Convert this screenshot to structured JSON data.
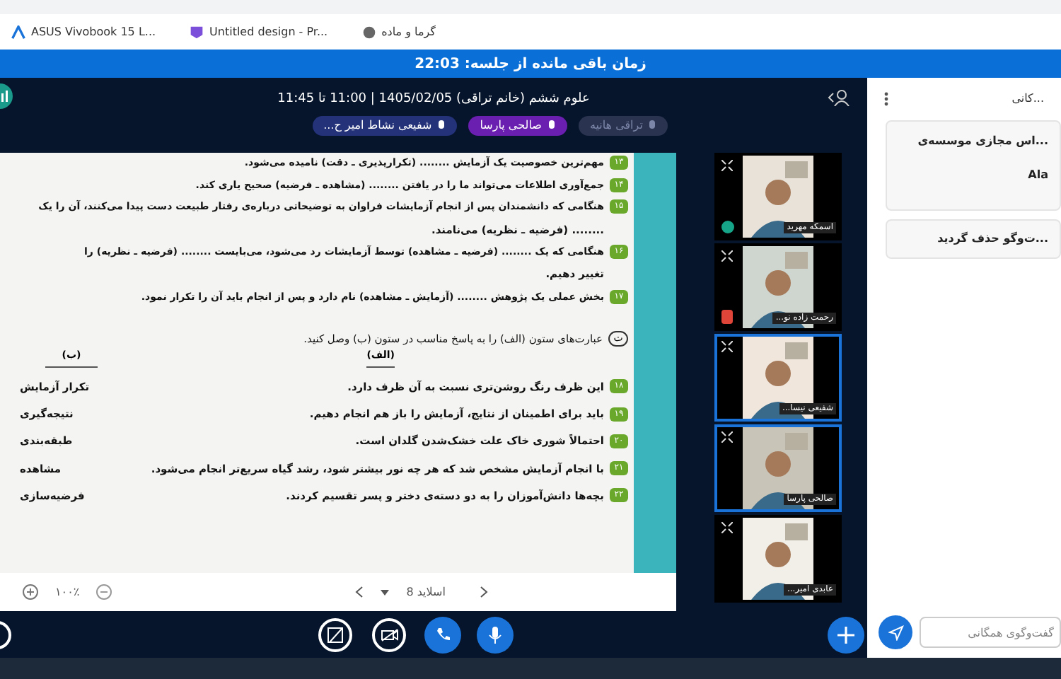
{
  "bookmarks": [
    {
      "label": "گرما و ماده"
    },
    {
      "label": "Untitled design - Pr..."
    },
    {
      "label": "ASUS Vivobook 15 L..."
    }
  ],
  "banner": "زمان باقی مانده از جلسه: 22:03",
  "session": {
    "title": "علوم ششم (خانم تراقی) 1405/02/05 | 11:00 تا 11:45",
    "talkers": [
      {
        "name": "تراقی هانیه",
        "active": false
      },
      {
        "name": "صالحی پارسا",
        "active": true
      },
      {
        "name": "شفیعی نشاط امیر ح...",
        "active": true
      }
    ]
  },
  "slide": {
    "questions": [
      {
        "num": "۱۳",
        "text": "مهم‌ترین خصوصیت یک آزمایش ........ (تکرارپذیری ـ دقت) نامیده می‌شود."
      },
      {
        "num": "۱۴",
        "text": "جمع‌آوری اطلاعات می‌تواند ما را در یافتن ........ (مشاهده ـ فرضیه) صحیح یاری کند."
      },
      {
        "num": "۱۵",
        "text": "هنگامی که دانشمندان پس از انجام آزمایشات فراوان به توضیحاتی درباره‌ی رفتار طبیعت دست پیدا می‌کنند، آن را یک",
        "cont": "........ (فرضیه ـ نظریه) می‌نامند."
      },
      {
        "num": "۱۶",
        "text": "هنگامی که یک ........ (فرضیه ـ مشاهده) توسط آزمایشات رد می‌شود، می‌بایست ........ (فرضیه ـ نظریه) را",
        "cont": "تغییر دهیم."
      },
      {
        "num": "۱۷",
        "text": "بخش عملی یک پژوهش ........ (آزمایش ـ مشاهده) نام دارد و پس از انجام باید آن را تکرار نمود."
      }
    ],
    "section_badge": "ت",
    "instruction": "عبارت‌های ستون (الف) را به پاسخ مناسب در ستون (ب) وصل کنید.",
    "col_a": "(الف)",
    "col_b": "(ب)",
    "matches": [
      {
        "num": "۱۸",
        "text": "این ظرف رنگ روشن‌تری نسبت به آن ظرف دارد.",
        "answer": "تکرار آزمایش"
      },
      {
        "num": "۱۹",
        "text": "باید برای اطمینان از نتایج، آزمایش را باز هم انجام دهیم.",
        "answer": "نتیجه‌گیری"
      },
      {
        "num": "۲۰",
        "text": "احتمالاً شوری خاک علت خشک‌شدن گلدان است.",
        "answer": "طبقه‌بندی"
      },
      {
        "num": "۲۱",
        "text": "با انجام آزمایش مشخص شد که هر چه نور بیشتر شود، رشد گیاه سریع‌تر انجام می‌شود.",
        "answer": "مشاهده"
      },
      {
        "num": "۲۲",
        "text": "بچه‌ها دانش‌آموزان را به دو دسته‌ی دختر و پسر تقسیم کردند.",
        "answer": "فرضیه‌سازی"
      }
    ],
    "zoom": "۱۰۰٪",
    "page": "اسلاید 8"
  },
  "webcams": [
    {
      "name": "اسمکه مهرید",
      "speaking": false,
      "moderator": true,
      "muted": false
    },
    {
      "name": "رحمت زاده نو...",
      "speaking": false,
      "moderator": false,
      "muted": true
    },
    {
      "name": "شفیعی نیسا...",
      "speaking": true
    },
    {
      "name": "صالحی پارسا",
      "speaking": true
    },
    {
      "name": "عابدی امیر...",
      "speaking": false
    }
  ],
  "chat": {
    "title": "...کانی",
    "messages": [
      {
        "text": "...اس مجازی موسسه‌ی",
        "sender": "Ala"
      },
      {
        "text": "...ت‌وگو حذف گردید"
      }
    ],
    "placeholder": "گفت‌وگوی همگانی"
  }
}
